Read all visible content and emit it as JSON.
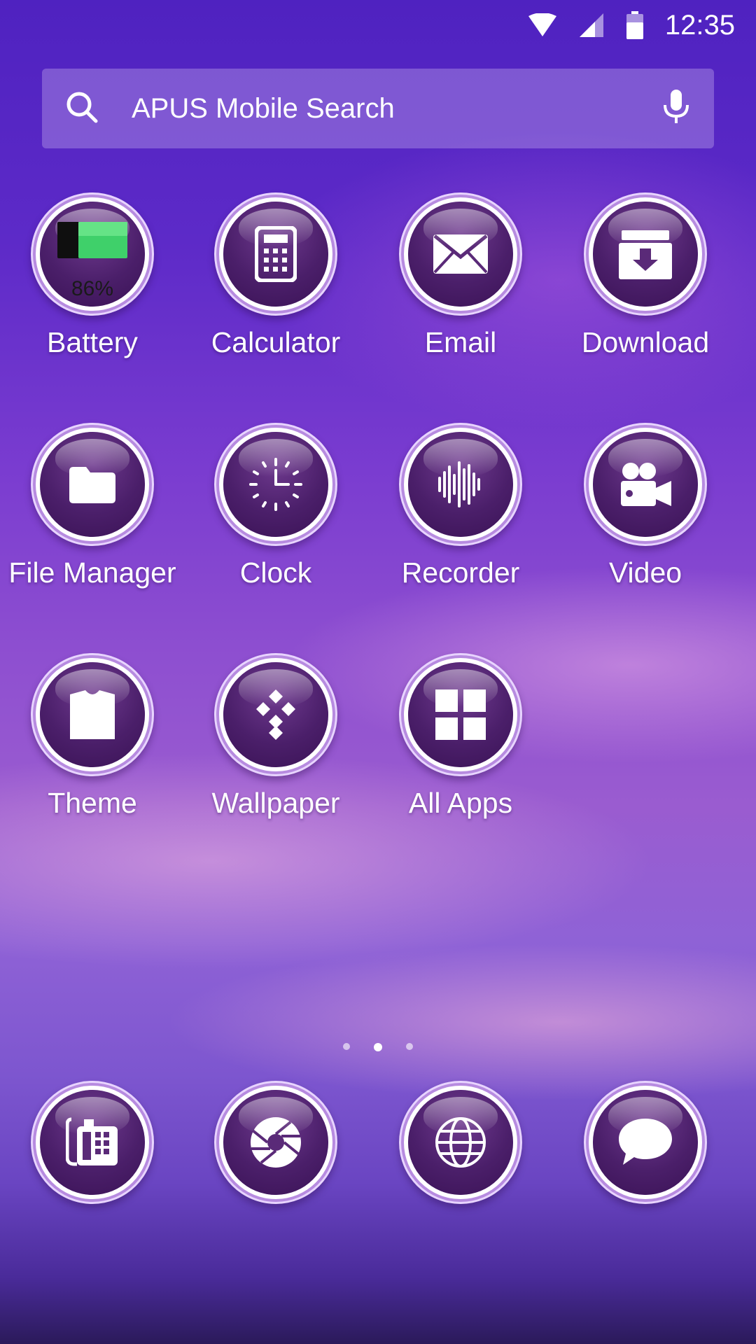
{
  "status_bar": {
    "time": "12:35",
    "icons": [
      "wifi-icon",
      "signal-icon",
      "battery-icon"
    ]
  },
  "search": {
    "placeholder": "APUS Mobile Search",
    "left_icon": "search-icon",
    "right_icon": "microphone-icon"
  },
  "apps": [
    {
      "label": "Battery",
      "icon": "battery-icon",
      "badge": "86%",
      "level": 0.86
    },
    {
      "label": "Calculator",
      "icon": "calculator-icon"
    },
    {
      "label": "Email",
      "icon": "envelope-icon"
    },
    {
      "label": "Download",
      "icon": "download-box-icon"
    },
    {
      "label": "File Manager",
      "icon": "folder-icon"
    },
    {
      "label": "Clock",
      "icon": "clock-icon"
    },
    {
      "label": "Recorder",
      "icon": "sound-wave-icon"
    },
    {
      "label": "Video",
      "icon": "video-camera-icon"
    },
    {
      "label": "Theme",
      "icon": "tshirt-icon"
    },
    {
      "label": "Wallpaper",
      "icon": "diamond-dots-icon"
    },
    {
      "label": "All Apps",
      "icon": "grid-icon"
    }
  ],
  "page_indicator": {
    "count": 3,
    "active_index": 1
  },
  "dock": [
    {
      "icon": "phone-icon"
    },
    {
      "icon": "camera-aperture-icon"
    },
    {
      "icon": "globe-icon"
    },
    {
      "icon": "chat-bubble-icon"
    }
  ]
}
